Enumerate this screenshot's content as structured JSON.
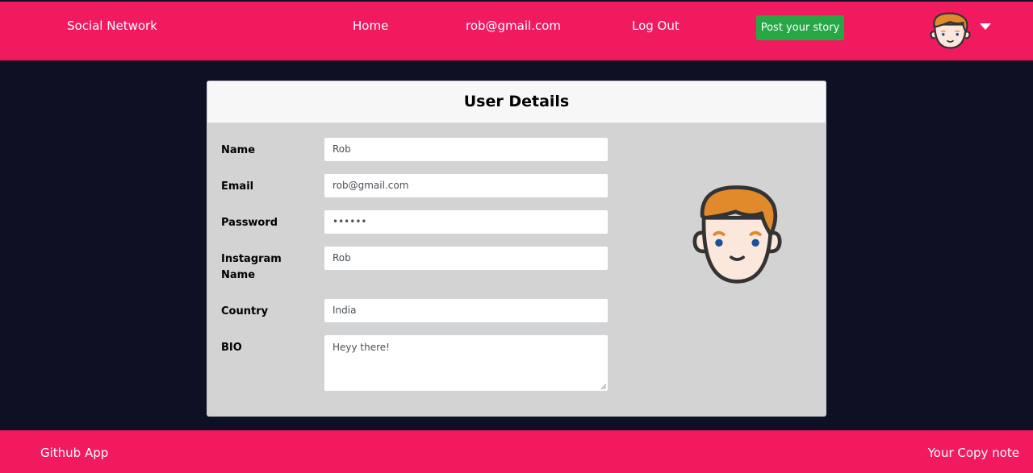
{
  "navbar": {
    "brand": "Social Network",
    "links": {
      "home": "Home",
      "email": "rob@gmail.com",
      "logout": "Log Out"
    },
    "post_button": "Post your story",
    "avatar_icon": "boy-avatar-icon",
    "dropdown_icon": "caret-down-icon"
  },
  "card": {
    "title": "User Details",
    "fields": {
      "name": {
        "label": "Name",
        "value": "Rob"
      },
      "email": {
        "label": "Email",
        "value": "rob@gmail.com"
      },
      "password": {
        "label": "Password",
        "value": "••••••"
      },
      "instagram_line1": "Instagram",
      "instagram_line2": "Name",
      "instagram_value": "Rob",
      "country": {
        "label": "Country",
        "value": "India"
      },
      "bio": {
        "label": "BIO",
        "value": "Heyy there!"
      }
    },
    "avatar_icon": "boy-avatar-icon"
  },
  "footer": {
    "left": "Github App",
    "right": "Your Copy note"
  },
  "colors": {
    "brand": "#f11a5f",
    "background": "#0f1023",
    "card": "#d3d3d3",
    "button": "#28a745",
    "hair": "#e08a2c"
  }
}
